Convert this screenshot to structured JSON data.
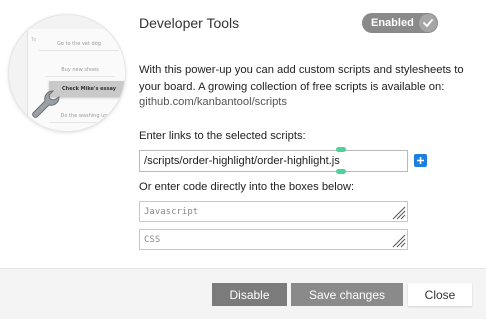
{
  "header": {
    "title": "Developer Tools",
    "toggle_label": "Enabled",
    "toggle_state": "enabled"
  },
  "illustration": {
    "cards": [
      "Go to the vet dog",
      "Buy new shoes",
      "Check Mike's essay",
      "Do the washing up"
    ],
    "side_text": "To"
  },
  "description": {
    "text": "With this power-up you can add custom scripts and stylesheets to your board. A growing collection of free scripts is available on:",
    "link": "github.com/kanbantool/scripts"
  },
  "scripts": {
    "label": "Enter links to the selected scripts:",
    "url_value": "/scripts/order-highlight/order-highlight.js"
  },
  "code": {
    "label": "Or enter code directly into the boxes below:",
    "js_placeholder": "Javascript",
    "css_placeholder": "CSS"
  },
  "footer": {
    "disable_label": "Disable",
    "save_label": "Save changes",
    "close_label": "Close"
  },
  "colors": {
    "accent": "#1c7fe0",
    "toggle_bg": "#8a8a8a",
    "button_dark": "#7b7b7b",
    "caret": "#4fd19a"
  }
}
